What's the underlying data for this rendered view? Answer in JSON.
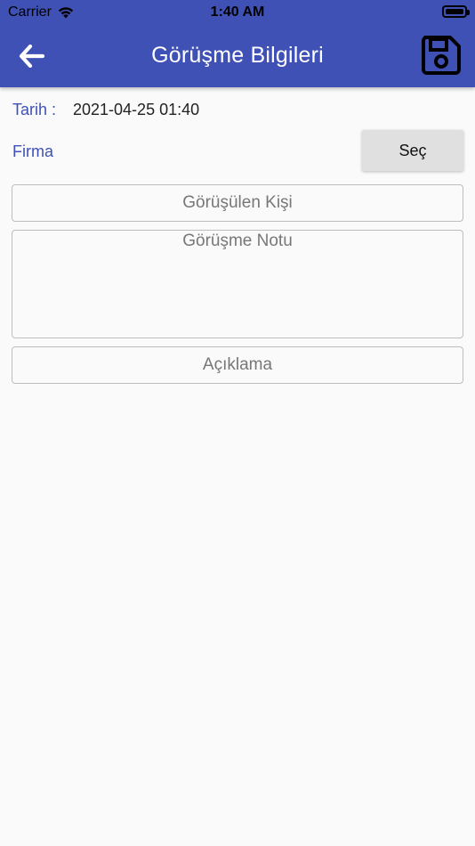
{
  "status_bar": {
    "carrier": "Carrier",
    "time": "1:40 AM"
  },
  "appbar": {
    "title": "Görüşme Bilgileri",
    "back_icon": "arrow-left-icon",
    "save_icon": "floppy-disk-icon",
    "background_color": "#3f51b5"
  },
  "form": {
    "tarih_label": "Tarih :",
    "tarih_value": "2021-04-25 01:40",
    "firma_label": "Firma",
    "sec_button_label": "Seç",
    "gorusulen_kisi_placeholder": "Görüşülen Kişi",
    "gorusme_notu_placeholder": "Görüşme Notu",
    "aciklama_placeholder": "Açıklama"
  }
}
